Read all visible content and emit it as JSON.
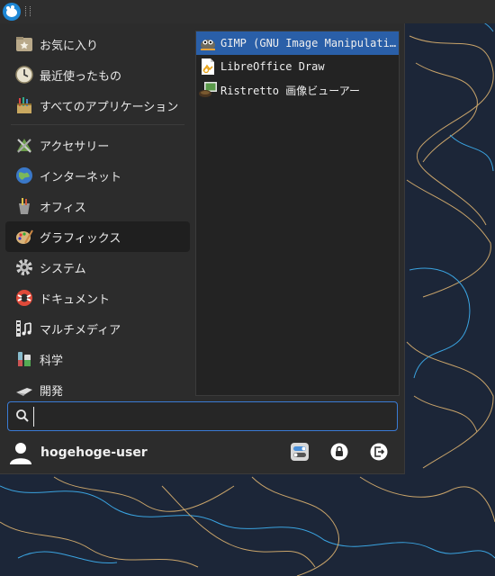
{
  "categories": [
    {
      "label": "お気に入り",
      "icon": "favorites-icon"
    },
    {
      "label": "最近使ったもの",
      "icon": "recent-icon"
    },
    {
      "label": "すべてのアプリケーション",
      "icon": "all-apps-icon"
    },
    {
      "label": "アクセサリー",
      "icon": "accessories-icon"
    },
    {
      "label": "インターネット",
      "icon": "internet-icon"
    },
    {
      "label": "オフィス",
      "icon": "office-icon"
    },
    {
      "label": "グラフィックス",
      "icon": "graphics-icon",
      "active": true
    },
    {
      "label": "システム",
      "icon": "system-icon"
    },
    {
      "label": "ドキュメント",
      "icon": "documentation-icon"
    },
    {
      "label": "マルチメディア",
      "icon": "multimedia-icon"
    },
    {
      "label": "科学",
      "icon": "science-icon"
    },
    {
      "label": "開発",
      "icon": "development-icon"
    }
  ],
  "apps": [
    {
      "label": "GIMP (GNU Image Manipulation Program)",
      "icon": "gimp-icon",
      "selected": true
    },
    {
      "label": "LibreOffice Draw",
      "icon": "libreoffice-draw-icon"
    },
    {
      "label": "Ristretto 画像ビューアー",
      "icon": "ristretto-icon"
    }
  ],
  "search": {
    "value": "",
    "placeholder": ""
  },
  "user": {
    "name": "hogehoge-user"
  },
  "colors": {
    "accent": "#2a5fa8",
    "menu_bg": "#2c2c2c",
    "desktop_bg": "#1c2638"
  }
}
